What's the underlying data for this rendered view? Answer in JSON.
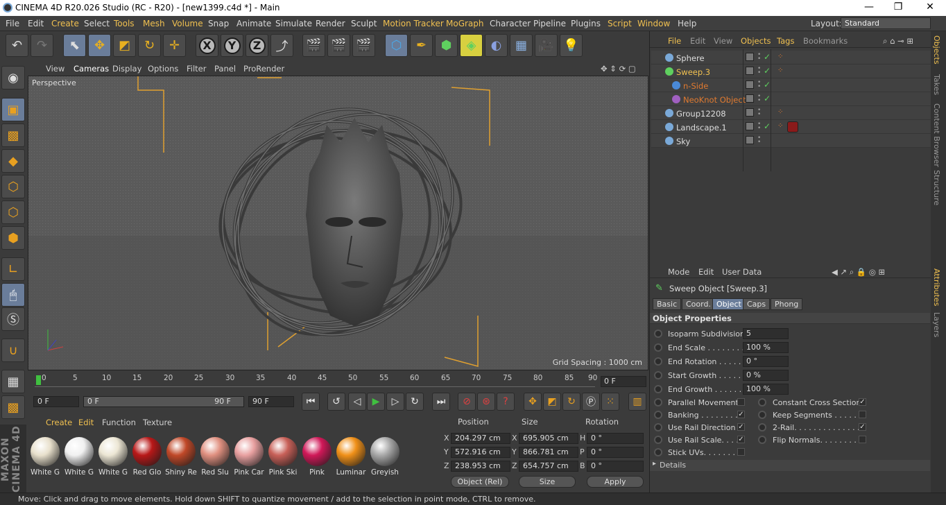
{
  "window": {
    "title": "CINEMA 4D R20.026 Studio (RC - R20) - [new1399.c4d *] - Main",
    "minimize": "—",
    "maximize": "❐",
    "close": "✕"
  },
  "menubar": {
    "items": [
      "File",
      "Edit",
      "Create",
      "Select",
      "Tools",
      "Mesh",
      "Volume",
      "Snap",
      "Animate",
      "Simulate",
      "Render",
      "Sculpt",
      "Motion Tracker",
      "MoGraph",
      "Character",
      "Pipeline",
      "Plugins",
      "Script",
      "Window",
      "Help"
    ],
    "layout_label": "Layout:",
    "layout_value": "Standard"
  },
  "viewport": {
    "menu": [
      "View",
      "Cameras",
      "Display",
      "Options",
      "Filter",
      "Panel",
      "ProRender"
    ],
    "camera": "Perspective",
    "grid_spacing": "Grid Spacing : 1000 cm"
  },
  "timeline": {
    "ticks": [
      "0",
      "5",
      "10",
      "15",
      "20",
      "25",
      "30",
      "35",
      "40",
      "45",
      "50",
      "55",
      "60",
      "65",
      "70",
      "75",
      "80",
      "85",
      "90"
    ],
    "current_frame": "0 F",
    "start_frame": "0 F",
    "range_start": "0 F",
    "range_end": "90 F",
    "end_frame": "90 F"
  },
  "materials": {
    "menu": [
      "Create",
      "Edit",
      "Function",
      "Texture"
    ],
    "items": [
      {
        "label": "White G",
        "color": "#e8e0cc"
      },
      {
        "label": "White G",
        "color": "#f0f0f0"
      },
      {
        "label": "White G",
        "color": "#ece6d4"
      },
      {
        "label": "Red Glo",
        "color": "#b81818"
      },
      {
        "label": "Shiny Re",
        "color": "#c04828"
      },
      {
        "label": "Red Slu",
        "color": "#e09080"
      },
      {
        "label": "Pink Car",
        "color": "#e8a0a0"
      },
      {
        "label": "Pink Ski",
        "color": "#c86058"
      },
      {
        "label": "Pink",
        "color": "#d01858"
      },
      {
        "label": "Luminar",
        "color": "#f09018"
      },
      {
        "label": "Greyish",
        "color": "#a8a8a8"
      }
    ]
  },
  "coords": {
    "headers": [
      "Position",
      "Size",
      "Rotation"
    ],
    "rows": [
      {
        "axis": "X",
        "pos": "204.297 cm",
        "size_axis": "X",
        "size": "695.905 cm",
        "rot_axis": "H",
        "rot": "0 °"
      },
      {
        "axis": "Y",
        "pos": "572.916 cm",
        "size_axis": "Y",
        "size": "866.781 cm",
        "rot_axis": "P",
        "rot": "0 °"
      },
      {
        "axis": "Z",
        "pos": "238.953 cm",
        "size_axis": "Z",
        "size": "654.757 cm",
        "rot_axis": "B",
        "rot": "0 °"
      }
    ],
    "mode": "Object (Rel)",
    "size_mode": "Size",
    "apply": "Apply"
  },
  "objects": {
    "menu": [
      "File",
      "Edit",
      "View",
      "Objects",
      "Tags",
      "Bookmarks"
    ],
    "items": [
      {
        "name": "Sphere",
        "color": "#ddd",
        "icon": "#7aa9d8"
      },
      {
        "name": "Sweep.3",
        "color": "#f0c050",
        "icon": "#5fd05f"
      },
      {
        "name": "n-Side",
        "color": "#e07a30",
        "icon": "#4a8ad8"
      },
      {
        "name": "NeoKnot Object",
        "color": "#e07a30",
        "icon": "#a060c0"
      },
      {
        "name": "Group12208",
        "color": "#ddd",
        "icon": "#7aa9d8"
      },
      {
        "name": "Landscape.1",
        "color": "#ddd",
        "icon": "#7aa9d8"
      },
      {
        "name": "Sky",
        "color": "#ddd",
        "icon": "#7aa9d8"
      }
    ]
  },
  "attributes": {
    "menu": [
      "Mode",
      "Edit",
      "User Data"
    ],
    "object_title": "Sweep Object [Sweep.3]",
    "tabs": [
      "Basic",
      "Coord.",
      "Object",
      "Caps",
      "Phong"
    ],
    "section": "Object Properties",
    "fields": [
      {
        "label": "Isoparm Subdivision",
        "value": "5"
      },
      {
        "label": "End Scale . . . . . . . . .",
        "value": "100 %"
      },
      {
        "label": "End Rotation . . . . . .",
        "value": "0 °"
      },
      {
        "label": "Start Growth . . . . . .",
        "value": "0 %"
      },
      {
        "label": "End Growth . . . . . . .",
        "value": "100 %"
      }
    ],
    "checks_left": [
      {
        "label": "Parallel Movement",
        "checked": ""
      },
      {
        "label": "Banking . . . . . . . . .",
        "checked": "✓"
      },
      {
        "label": "Use Rail Direction",
        "checked": "✓"
      },
      {
        "label": "Use Rail Scale. . . .",
        "checked": "✓"
      },
      {
        "label": "Stick UVs. . . . . . . .",
        "checked": ""
      }
    ],
    "checks_right": [
      {
        "label": "Constant Cross Section",
        "checked": "✓"
      },
      {
        "label": "Keep Segments . . . . . .",
        "checked": ""
      },
      {
        "label": "2-Rail. . . . . . . . . . . . . . .",
        "checked": "✓"
      },
      {
        "label": "Flip Normals. . . . . . . . .",
        "checked": ""
      }
    ],
    "details": "Details"
  },
  "sidetabs": {
    "top": [
      "Objects",
      "Takes",
      "Content Browser",
      "Structure"
    ],
    "bottom": [
      "Attributes",
      "Layers"
    ]
  },
  "status": "Move: Click and drag to move elements. Hold down SHIFT to quantize movement / add to the selection in point mode, CTRL to remove."
}
